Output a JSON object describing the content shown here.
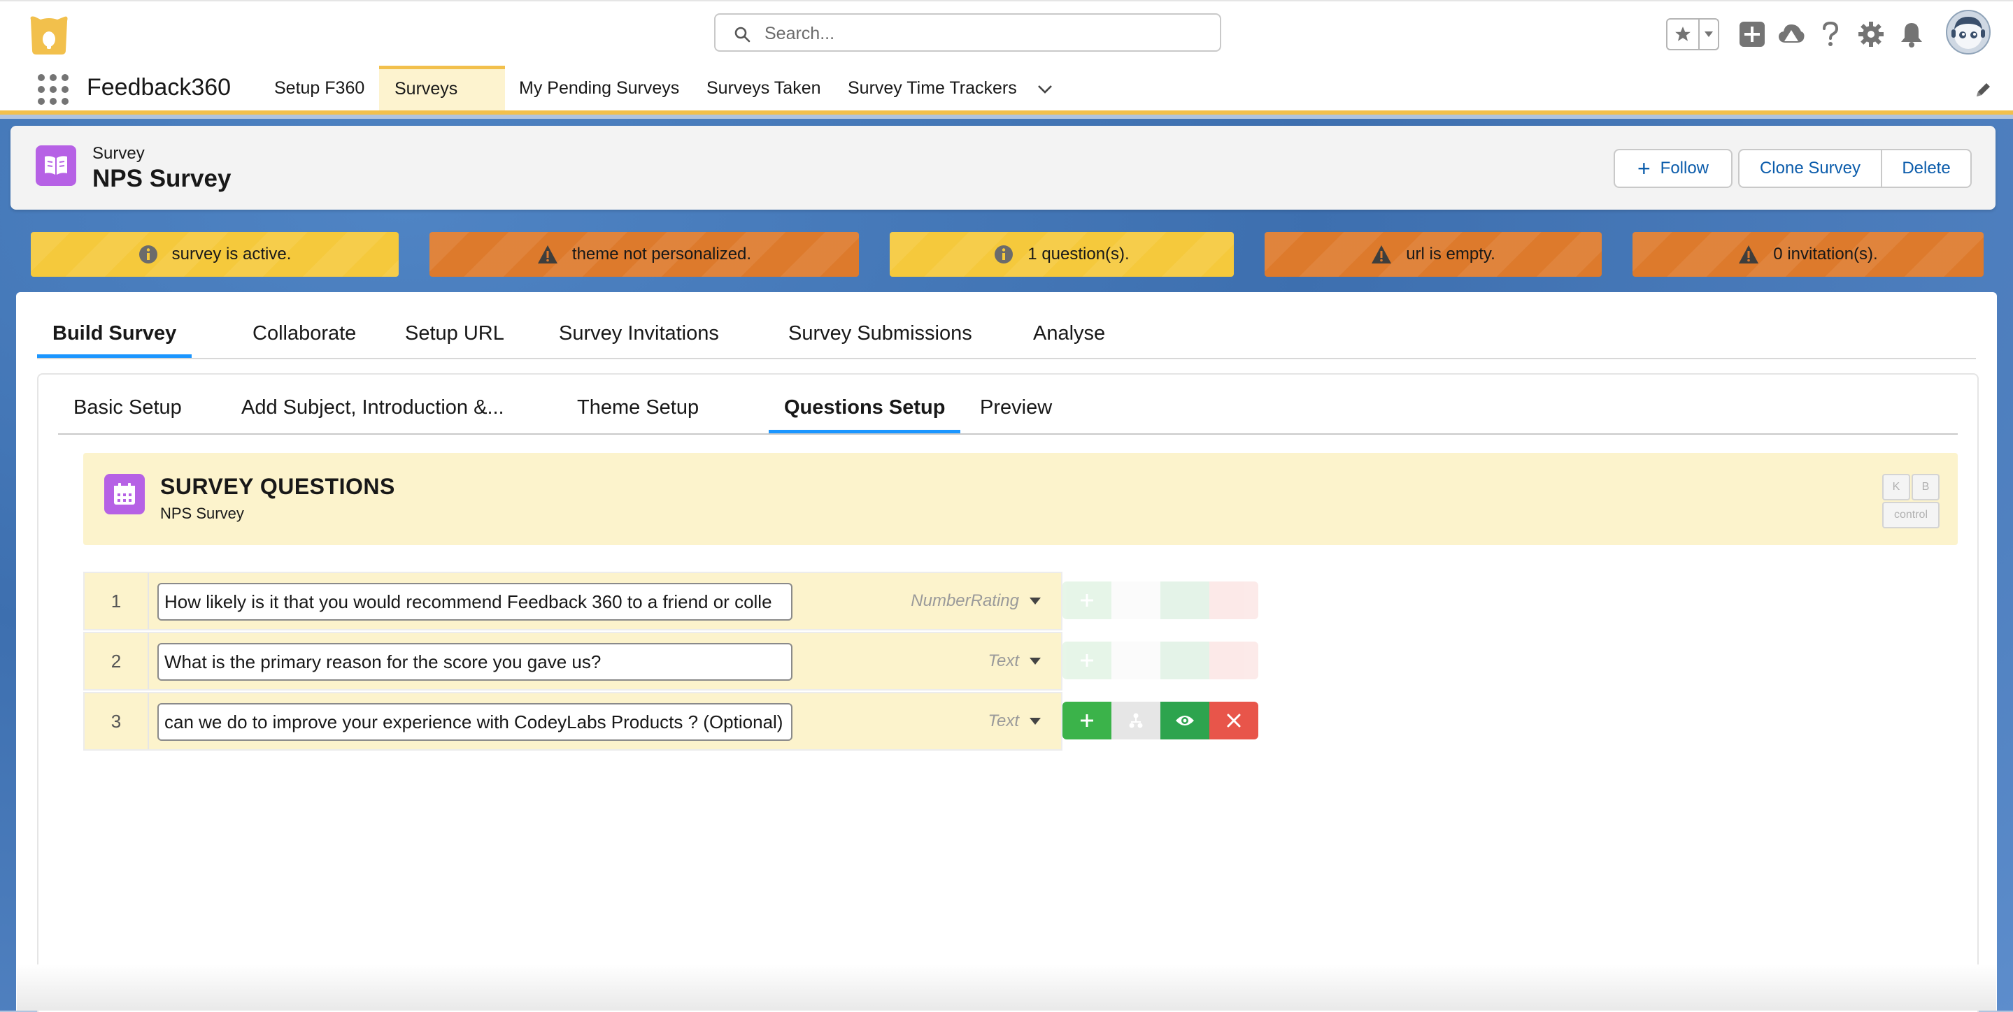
{
  "search": {
    "placeholder": "Search..."
  },
  "app": {
    "name": "Feedback360"
  },
  "nav": {
    "items": [
      {
        "label": "Setup F360"
      },
      {
        "label": "Surveys"
      },
      {
        "label": "My Pending Surveys"
      },
      {
        "label": "Surveys Taken"
      },
      {
        "label": "Survey Time Trackers"
      }
    ]
  },
  "record": {
    "type": "Survey",
    "title": "NPS Survey",
    "buttons": {
      "follow": "Follow",
      "clone": "Clone Survey",
      "delete": "Delete"
    }
  },
  "banners": [
    {
      "text": "survey is active.",
      "kind": "info",
      "icon": "info-icon"
    },
    {
      "text": "theme not personalized.",
      "kind": "warning",
      "icon": "warning-icon"
    },
    {
      "text": "1 question(s).",
      "kind": "info",
      "icon": "info-icon"
    },
    {
      "text": "url is empty.",
      "kind": "warning",
      "icon": "warning-icon"
    },
    {
      "text": "0 invitation(s).",
      "kind": "warning",
      "icon": "warning-icon"
    }
  ],
  "tabs": [
    {
      "label": "Build Survey",
      "active": true
    },
    {
      "label": "Collaborate"
    },
    {
      "label": "Setup URL"
    },
    {
      "label": "Survey Invitations"
    },
    {
      "label": "Survey Submissions"
    },
    {
      "label": "Analyse"
    }
  ],
  "subtabs": [
    {
      "label": "Basic Setup"
    },
    {
      "label": "Add Subject, Introduction &..."
    },
    {
      "label": "Theme Setup"
    },
    {
      "label": "Questions Setup",
      "active": true
    },
    {
      "label": "Preview"
    }
  ],
  "survey_questions": {
    "title": "SURVEY QUESTIONS",
    "subtitle": "NPS Survey",
    "kbd": {
      "k": "K",
      "b": "B",
      "control": "control"
    }
  },
  "questions": [
    {
      "number": "1",
      "text": "How likely is it that you would recommend Feedback 360 to a friend or colle",
      "type": "NumberRating"
    },
    {
      "number": "2",
      "text": "What is the primary reason for the score you gave us?",
      "type": "Text"
    },
    {
      "number": "3",
      "text": "can we do to improve your experience with CodeyLabs Products ? (Optional)",
      "type": "Text"
    }
  ],
  "colors": {
    "brand_yellow": "#f2c04c",
    "info_banner": "#f5c93c",
    "warning_banner": "#dd7a2c",
    "link_blue": "#0b5cab",
    "active_tab": "#1b96ff",
    "record_icon": "#b661e5"
  }
}
